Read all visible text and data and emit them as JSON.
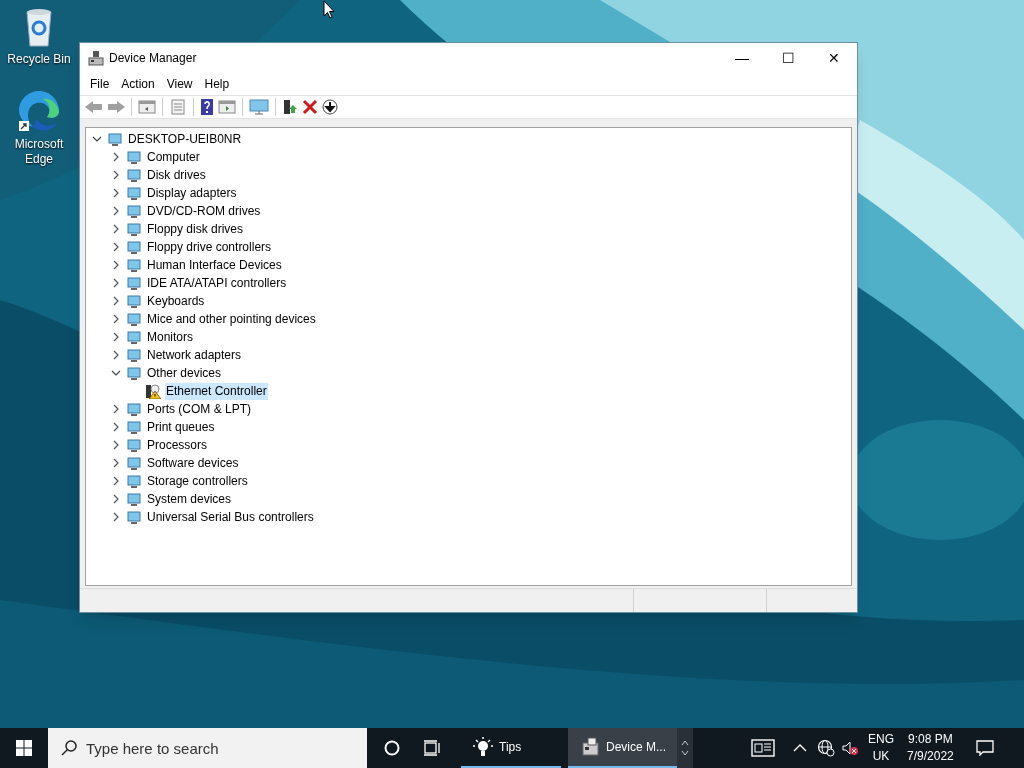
{
  "desktop_icons": [
    {
      "label": "Recycle Bin",
      "kind": "bin"
    },
    {
      "label": "Microsoft Edge",
      "kind": "edge"
    }
  ],
  "window": {
    "title": "Device Manager",
    "controls": [
      "—",
      "☐",
      "✕"
    ]
  },
  "menu": [
    "File",
    "Action",
    "View",
    "Help"
  ],
  "tree": {
    "label": "DESKTOP-UEIB0NR",
    "expanded": true,
    "selected": false,
    "children": [
      {
        "label": "Computer",
        "expanded": false,
        "selected": false
      },
      {
        "label": "Disk drives",
        "expanded": false,
        "selected": false
      },
      {
        "label": "Display adapters",
        "expanded": false,
        "selected": false
      },
      {
        "label": "DVD/CD-ROM drives",
        "expanded": false,
        "selected": false
      },
      {
        "label": "Floppy disk drives",
        "expanded": false,
        "selected": false
      },
      {
        "label": "Floppy drive controllers",
        "expanded": false,
        "selected": false
      },
      {
        "label": "Human Interface Devices",
        "expanded": false,
        "selected": false
      },
      {
        "label": "IDE ATA/ATAPI controllers",
        "expanded": false,
        "selected": false
      },
      {
        "label": "Keyboards",
        "expanded": false,
        "selected": false
      },
      {
        "label": "Mice and other pointing devices",
        "expanded": false,
        "selected": false
      },
      {
        "label": "Monitors",
        "expanded": false,
        "selected": false
      },
      {
        "label": "Network adapters",
        "expanded": false,
        "selected": false
      },
      {
        "label": "Other devices",
        "expanded": true,
        "selected": false,
        "children": [
          {
            "label": "Ethernet Controller",
            "selected": true,
            "warning": true
          }
        ]
      },
      {
        "label": "Ports (COM & LPT)",
        "expanded": false,
        "selected": false
      },
      {
        "label": "Print queues",
        "expanded": false,
        "selected": false
      },
      {
        "label": "Processors",
        "expanded": false,
        "selected": false
      },
      {
        "label": "Software devices",
        "expanded": false,
        "selected": false
      },
      {
        "label": "Storage controllers",
        "expanded": false,
        "selected": false
      },
      {
        "label": "System devices",
        "expanded": false,
        "selected": false
      },
      {
        "label": "Universal Serial Bus controllers",
        "expanded": false,
        "selected": false
      }
    ]
  },
  "taskbar": {
    "search": {
      "placeholder": "Type here to search"
    },
    "apps": [
      {
        "label": "Tips",
        "kind": "tips",
        "selected": false
      },
      {
        "label": "Device M...",
        "kind": "devmgr",
        "selected": true
      }
    ],
    "language": [
      "ENG",
      "UK"
    ],
    "time": "9:08 PM",
    "date": "7/9/2022"
  }
}
